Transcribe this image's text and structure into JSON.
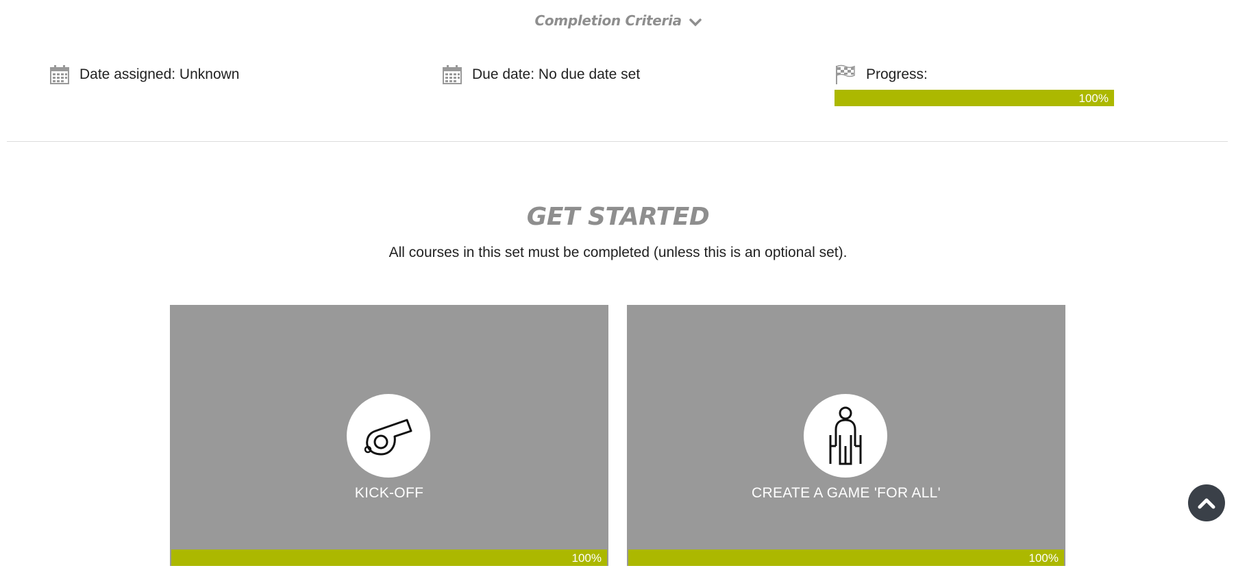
{
  "completion_criteria": {
    "label": "Completion Criteria",
    "icon": "chevron-down-icon"
  },
  "info": {
    "date_assigned": {
      "label": "Date assigned: Unknown",
      "icon": "calendar-icon"
    },
    "due_date": {
      "label": "Due date: No due date set",
      "icon": "calendar-icon"
    },
    "progress": {
      "label": "Progress:",
      "icon": "checkered-flag-icon",
      "value_label": "100%",
      "value": 1.0
    }
  },
  "section": {
    "title": "GET STARTED",
    "description": "All courses in this set must be completed (unless this is an optional set)."
  },
  "courses": [
    {
      "title": "KICK-OFF",
      "icon": "whistle-icon",
      "progress_label": "100%",
      "progress": 1.0
    },
    {
      "title": "CREATE A GAME 'FOR ALL'",
      "icon": "person-with-crutches-icon",
      "progress_label": "100%",
      "progress": 1.0
    }
  ],
  "back_to_top": {
    "icon": "chevron-up-icon"
  },
  "colors": {
    "accent": "#acb800",
    "card_bg": "#999999",
    "heading_gray": "#8e8e8e",
    "button_dark": "#3a4048"
  }
}
